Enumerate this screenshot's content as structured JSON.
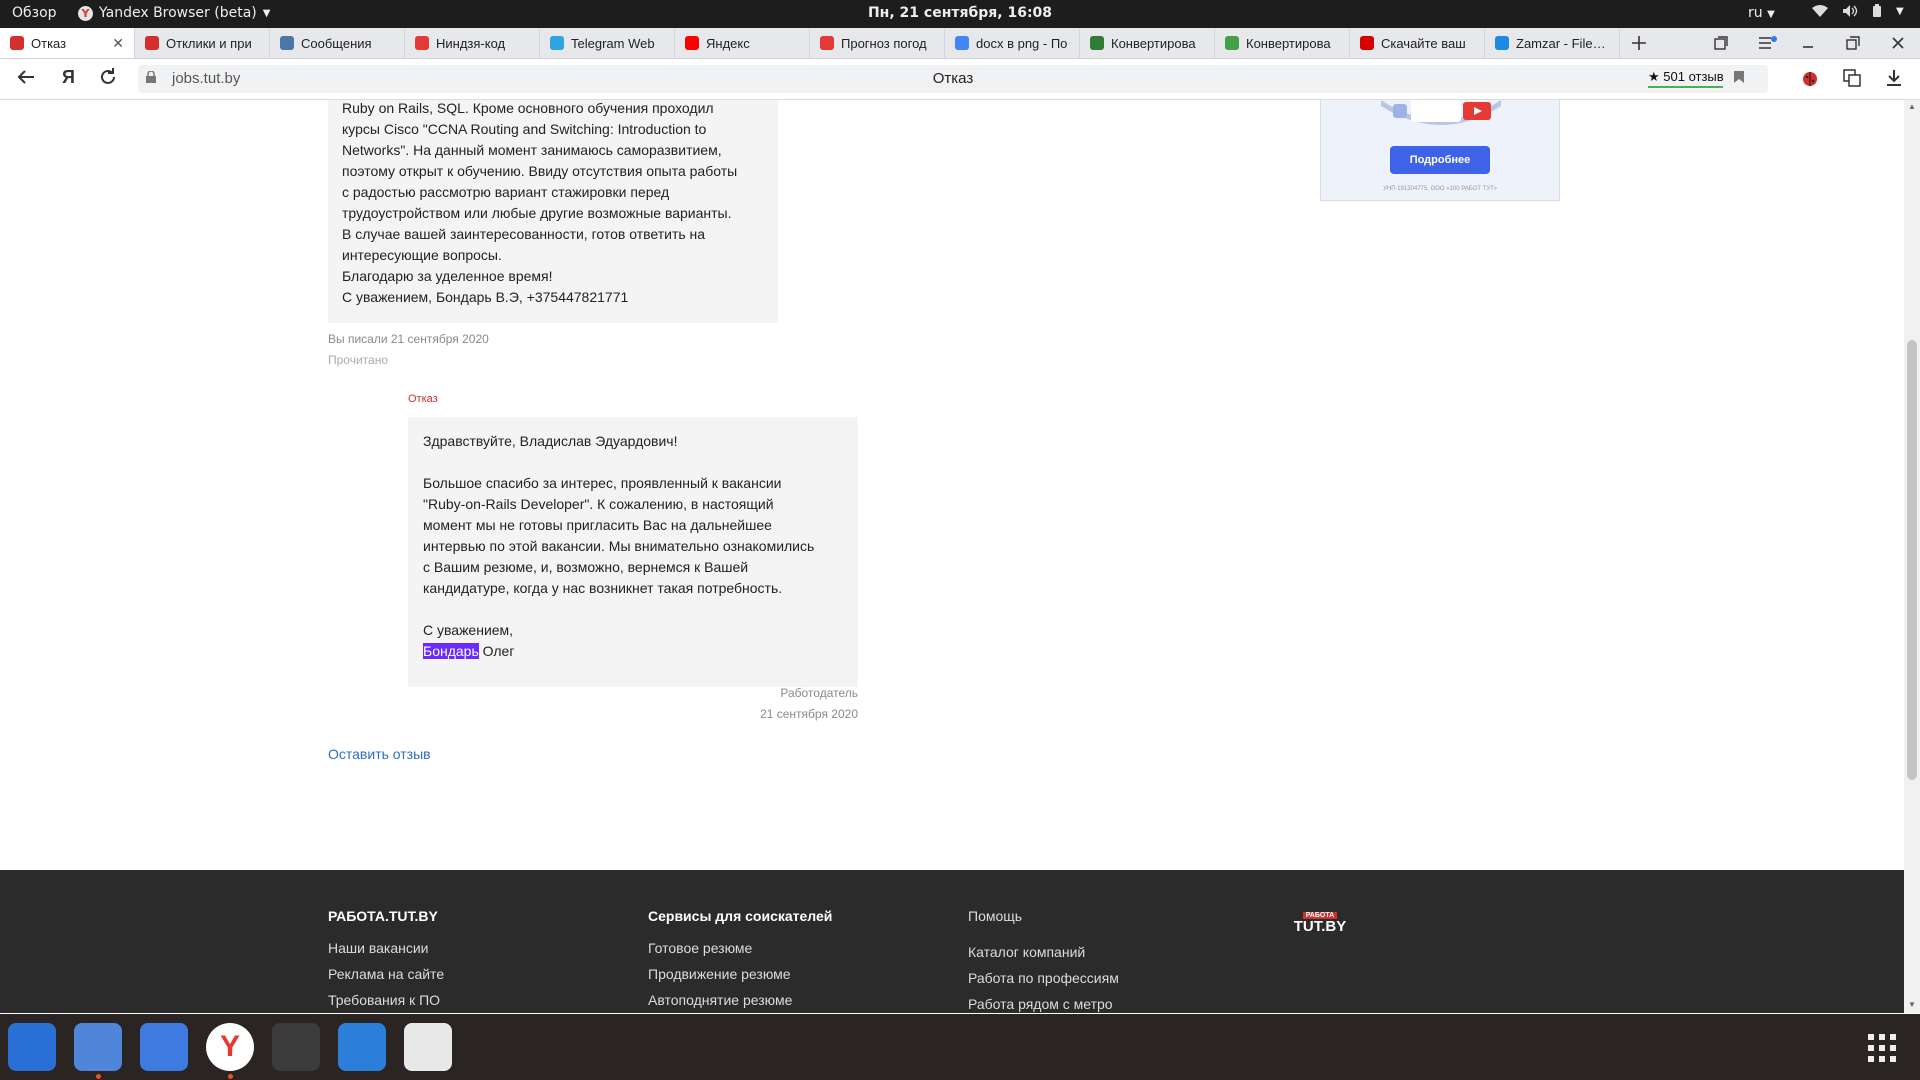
{
  "topbar": {
    "overview": "Обзор",
    "app_name": "Yandex Browser (beta)",
    "clock": "Пн, 21 сентября, 16:08",
    "lang": "ru"
  },
  "tabs": [
    {
      "title": "Отказ",
      "favicon_color": "#d32f2f",
      "active": true
    },
    {
      "title": "Отклики и при",
      "favicon_color": "#d32f2f",
      "active": false
    },
    {
      "title": "Сообщения",
      "favicon_color": "#4a76a8",
      "active": false
    },
    {
      "title": "Ниндзя-код",
      "favicon_color": "#e53935",
      "active": false
    },
    {
      "title": "Telegram Web",
      "favicon_color": "#2ca5e0",
      "active": false
    },
    {
      "title": "Яндекс",
      "favicon_color": "#ff0000",
      "active": false
    },
    {
      "title": "Прогноз погод",
      "favicon_color": "#e53935",
      "active": false
    },
    {
      "title": "docx в png - По",
      "favicon_color": "#4285f4",
      "active": false
    },
    {
      "title": "Конвертирова",
      "favicon_color": "#2e7d32",
      "active": false
    },
    {
      "title": "Конвертирова",
      "favicon_color": "#43a047",
      "active": false
    },
    {
      "title": "Скачайте ваш",
      "favicon_color": "#d50000",
      "active": false
    },
    {
      "title": "Zamzar - File co",
      "favicon_color": "#1e88e5",
      "active": false
    }
  ],
  "address": {
    "url": "jobs.tut.by",
    "page_title": "Отказ",
    "reviews": "★ 501 отзыв"
  },
  "applicant_message": {
    "lines": [
      "Ruby on Rails, SQL. Кроме основного обучения проходил",
      "курсы Cisco \"CCNA Routing and Switching: Introduction to",
      "Networks\". На данный момент занимаюсь саморазвитием,",
      "поэтому открыт к обучению. Ввиду отсутствия опыта работы",
      "с радостью рассмотрю вариант стажировки перед",
      "трудоустройством или любые другие возможные варианты.",
      "В случае вашей заинтересованности, готов ответить на",
      "интересующие вопросы.",
      "Благодарю за уделенное время!",
      "С уважением, Бондарь В.Э, +375447821771"
    ],
    "sent_label": "Вы писали 21 сентября 2020",
    "status": "Прочитано"
  },
  "employer_message": {
    "label": "Отказ",
    "greeting": "Здравствуйте, Владислав Эдуардович!",
    "body_lines": [
      "Большое спасибо за интерес, проявленный к вакансии",
      "\"Ruby-on-Rails Developer\". К сожалению, в настоящий",
      "момент мы не готовы пригласить Вас на дальнейшее",
      "интервью по этой вакансии. Мы внимательно ознакомились",
      "с Вашим резюме, и, возможно, вернемся к Вашей",
      "кандидатуре, когда у нас возникнет такая потребность."
    ],
    "closing": "С уважением,",
    "signature_highlighted": "Бондарь",
    "signature_rest": " Олег",
    "author_role": "Работодатель",
    "date": "21 сентября 2020"
  },
  "leave_review": "Оставить отзыв",
  "ad": {
    "button": "Подробнее",
    "legal": "УНП 191304775, ООО «100 РАБОТ ТУТ»"
  },
  "footer": {
    "col1": {
      "title": "РАБОТА.TUT.BY",
      "links": [
        "Наши вакансии",
        "Реклама на сайте",
        "Требования к ПО"
      ]
    },
    "col2": {
      "title": "Сервисы для соискателей",
      "links": [
        "Готовое резюме",
        "Продвижение резюме",
        "Автоподнятие резюме"
      ]
    },
    "col3": {
      "title": "Помощь",
      "links": [
        "Каталог компаний",
        "Работа по профессиям",
        "Работа рядом с метро"
      ]
    },
    "logo_top": "РАБОТА",
    "logo_main": "TUT.BY"
  },
  "dock": [
    {
      "name": "settings-app-icon",
      "color": "#2a6fd6",
      "running": false
    },
    {
      "name": "files-app-icon",
      "color": "#4f86d9",
      "running": true
    },
    {
      "name": "chromium-app-icon",
      "color": "#3e7be0",
      "running": false
    },
    {
      "name": "yandex-browser-app-icon",
      "color": "#ffffff",
      "running": true
    },
    {
      "name": "sublime-text-app-icon",
      "color": "#3b3b3b",
      "running": false
    },
    {
      "name": "libreoffice-writer-app-icon",
      "color": "#2b7fd8",
      "running": false
    },
    {
      "name": "software-app-icon",
      "color": "#e8e8e8",
      "running": false
    }
  ]
}
